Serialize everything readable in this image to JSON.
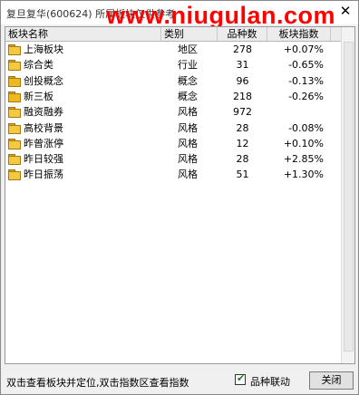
{
  "window": {
    "title": "复旦复华(600624) 所属板块仅供参考",
    "watermark": "www.niugulan.com",
    "close_icon": "close-icon"
  },
  "table": {
    "columns": [
      "板块名称",
      "类别",
      "品种数",
      "板块指数"
    ],
    "rows": [
      {
        "name": "上海板块",
        "category": "地区",
        "count": "278",
        "index": "+0.07%",
        "icon": "folder-icon"
      },
      {
        "name": "综合类",
        "category": "行业",
        "count": "31",
        "index": "-0.65%",
        "icon": "folder-icon"
      },
      {
        "name": "创投概念",
        "category": "概念",
        "count": "96",
        "index": "-0.13%",
        "icon": "folder-icon"
      },
      {
        "name": "新三板",
        "category": "概念",
        "count": "218",
        "index": "-0.26%",
        "icon": "folder-icon"
      },
      {
        "name": "融资融券",
        "category": "风格",
        "count": "972",
        "index": "",
        "icon": "folder-icon"
      },
      {
        "name": "高校背景",
        "category": "风格",
        "count": "28",
        "index": "-0.08%",
        "icon": "folder-icon"
      },
      {
        "name": "昨曾涨停",
        "category": "风格",
        "count": "12",
        "index": "+0.10%",
        "icon": "folder-icon"
      },
      {
        "name": "昨日较强",
        "category": "风格",
        "count": "28",
        "index": "+2.85%",
        "icon": "folder-icon"
      },
      {
        "name": "昨日振荡",
        "category": "风格",
        "count": "51",
        "index": "+1.30%",
        "icon": "folder-icon"
      }
    ]
  },
  "status": {
    "hint": "双击查看板块并定位,双击指数区查看指数",
    "checkbox_label": "品种联动",
    "checkbox_checked": true,
    "close_label": "关闭"
  }
}
